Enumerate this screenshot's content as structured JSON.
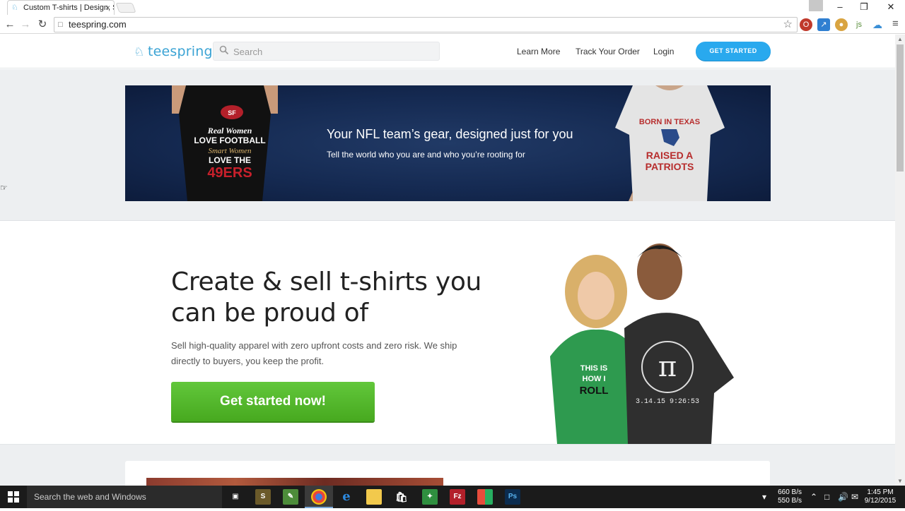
{
  "browser": {
    "tab_title": "Custom T-shirts | Design, Sell",
    "url": "teespring.com"
  },
  "header": {
    "logo_text": "teespring",
    "search_placeholder": "Search",
    "nav": [
      "Learn More",
      "Track Your Order",
      "Login"
    ],
    "cta_label": "GET STARTED"
  },
  "banner": {
    "title": "Your NFL team’s gear, designed just for you",
    "subtitle": "Tell the world who you are and who you’re rooting for"
  },
  "hero": {
    "heading": "Create & sell t-shirts you can be proud of",
    "body": "Sell high-quality apparel with zero upfront costs and zero risk. We ship directly to buyers, you keep the profit.",
    "button_label": "Get started now!"
  },
  "taskbar": {
    "search_text": "Search the web and Windows",
    "net_down": "660 B/s",
    "net_up": "550 B/s",
    "time": "1:45 PM",
    "date": "9/12/2015"
  },
  "colors": {
    "brand_blue": "#29a9ee",
    "cta_green": "#55b82c",
    "banner_navy": "#152a52"
  },
  "icons": [
    "back-icon",
    "forward-icon",
    "reload-icon",
    "star-icon",
    "search-icon",
    "windows-icon",
    "chrome-icon",
    "edge-icon",
    "photoshop-icon"
  ]
}
